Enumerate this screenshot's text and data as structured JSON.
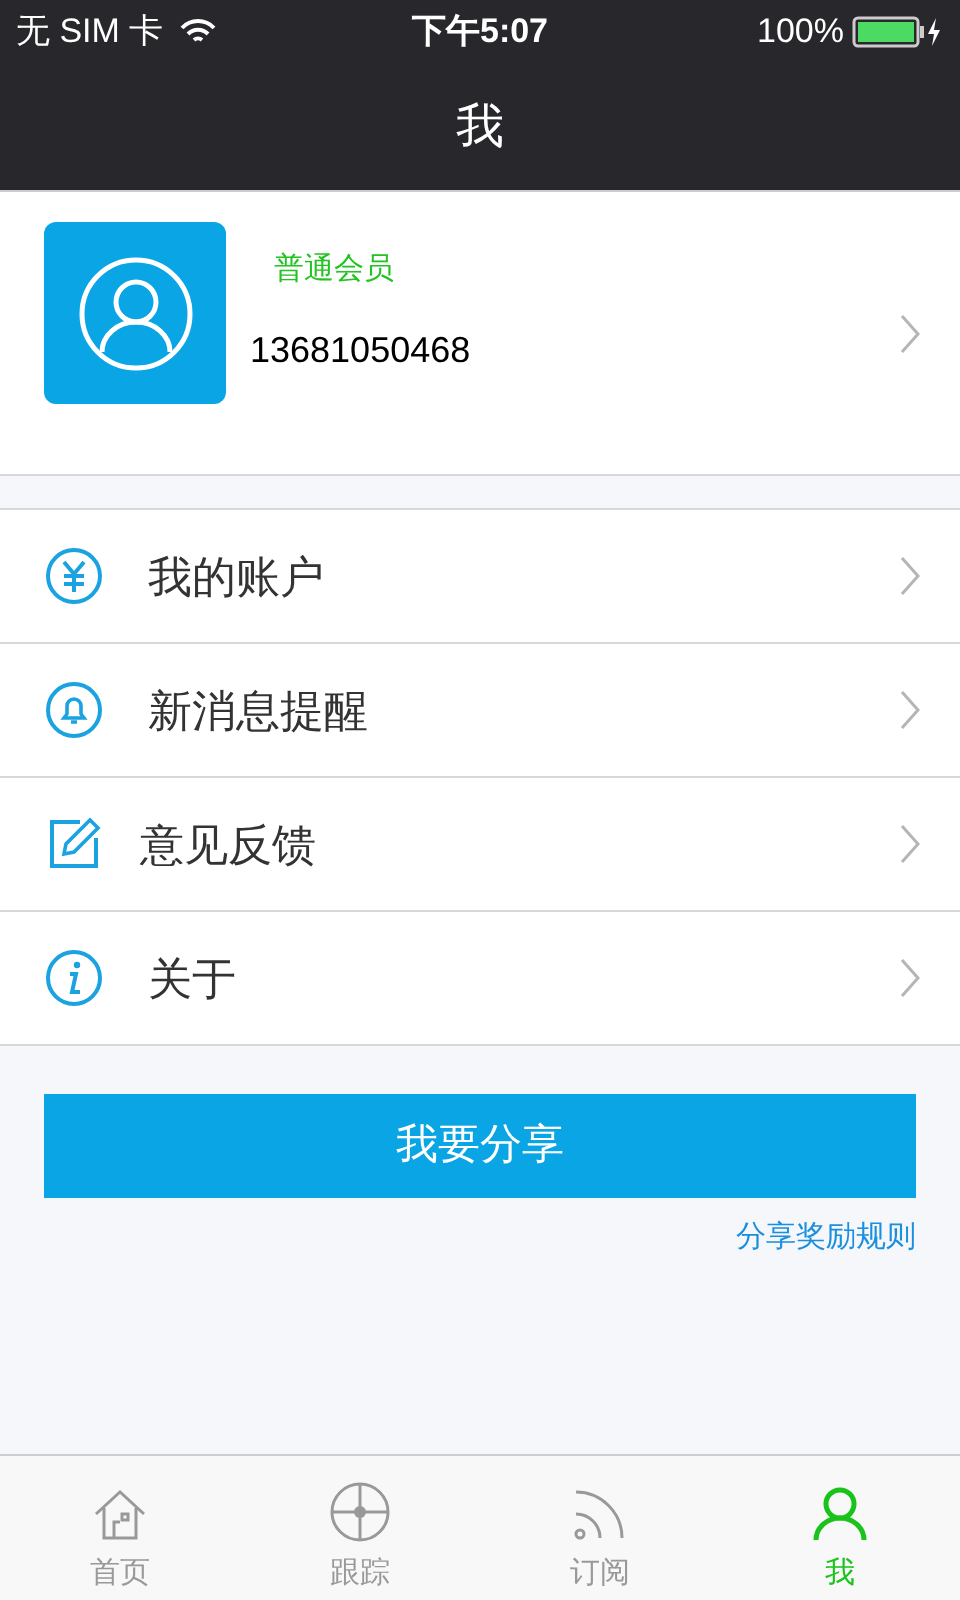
{
  "status_bar": {
    "carrier": "无 SIM 卡",
    "time": "下午5:07",
    "battery": "100%"
  },
  "nav": {
    "title": "我"
  },
  "profile": {
    "member_level": "普通会员",
    "phone": "13681050468"
  },
  "menu": [
    {
      "kind": "yuan",
      "label": "我的账户"
    },
    {
      "kind": "bell",
      "label": "新消息提醒"
    },
    {
      "kind": "edit",
      "label": "意见反馈"
    },
    {
      "kind": "info",
      "label": "关于"
    }
  ],
  "share_button": "我要分享",
  "share_rules_link": "分享奖励规则",
  "tabs": [
    {
      "kind": "home",
      "label": "首页",
      "selected": false
    },
    {
      "kind": "track",
      "label": "跟踪",
      "selected": false
    },
    {
      "kind": "feed",
      "label": "订阅",
      "selected": false
    },
    {
      "kind": "me",
      "label": "我",
      "selected": true
    }
  ]
}
